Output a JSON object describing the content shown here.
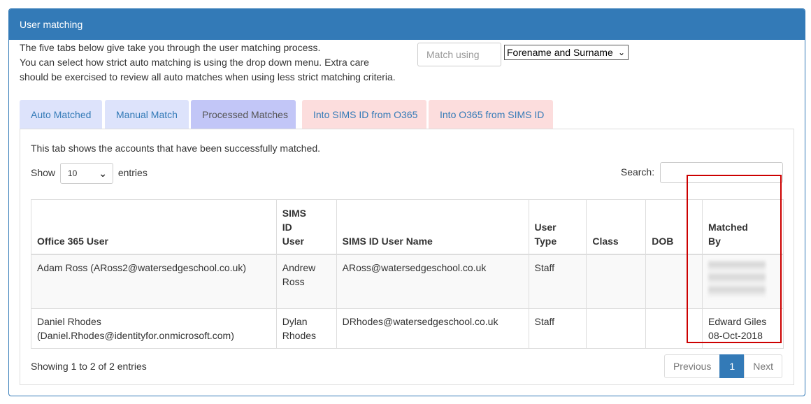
{
  "panel": {
    "title": "User matching"
  },
  "intro": [
    "The five tabs below give take you through the user matching process.",
    "You can select how strict auto matching is using the drop down menu. Extra care",
    "should be exercised to review all auto matches when using less strict matching criteria."
  ],
  "match": {
    "label": "Match using",
    "selected": "Forename and Surname"
  },
  "tabs": [
    "Auto Matched",
    "Manual Match",
    "Processed Matches",
    "Into SIMS ID from O365",
    "Into O365 from SIMS ID"
  ],
  "content": {
    "description": "This tab shows the accounts that have been successfully matched.",
    "show_label": "Show",
    "entries_value": "10",
    "entries_label": "entries",
    "search_label": "Search:"
  },
  "table": {
    "headers": {
      "office_user": "Office 365 User",
      "sims_user_1": "SIMS",
      "sims_user_2": "ID",
      "sims_user_3": "User",
      "sims_name": "SIMS ID User Name",
      "user_type_1": "User",
      "user_type_2": "Type",
      "class": "Class",
      "dob": "DOB",
      "matched_1": "Matched",
      "matched_2": "By"
    },
    "rows": [
      {
        "office_user": "Adam Ross (ARoss2@watersedgeschool.co.uk)",
        "sims_user_1": "Andrew",
        "sims_user_2": "Ross",
        "sims_name": "ARoss@watersedgeschool.co.uk",
        "user_type": "Staff",
        "class": "",
        "dob": ""
      },
      {
        "office_user_1": "Daniel Rhodes",
        "office_user_2": "(Daniel.Rhodes@identityfor.onmicrosoft.com)",
        "sims_user_1": "Dylan",
        "sims_user_2": "Rhodes",
        "sims_name": "DRhodes@watersedgeschool.co.uk",
        "user_type": "Staff",
        "class": "",
        "dob": "",
        "matched_by_1": "Edward Giles",
        "matched_by_2": "08-Oct-2018"
      }
    ]
  },
  "footer": {
    "info": "Showing 1 to 2 of 2 entries",
    "previous": "Previous",
    "current_page": "1",
    "next": "Next"
  },
  "colors": {
    "primary": "#337ab7",
    "tab_blue": "#dde3fb",
    "tab_active": "#c2c6f7",
    "tab_pink": "#fcdddd",
    "highlight": "#cc0000"
  }
}
